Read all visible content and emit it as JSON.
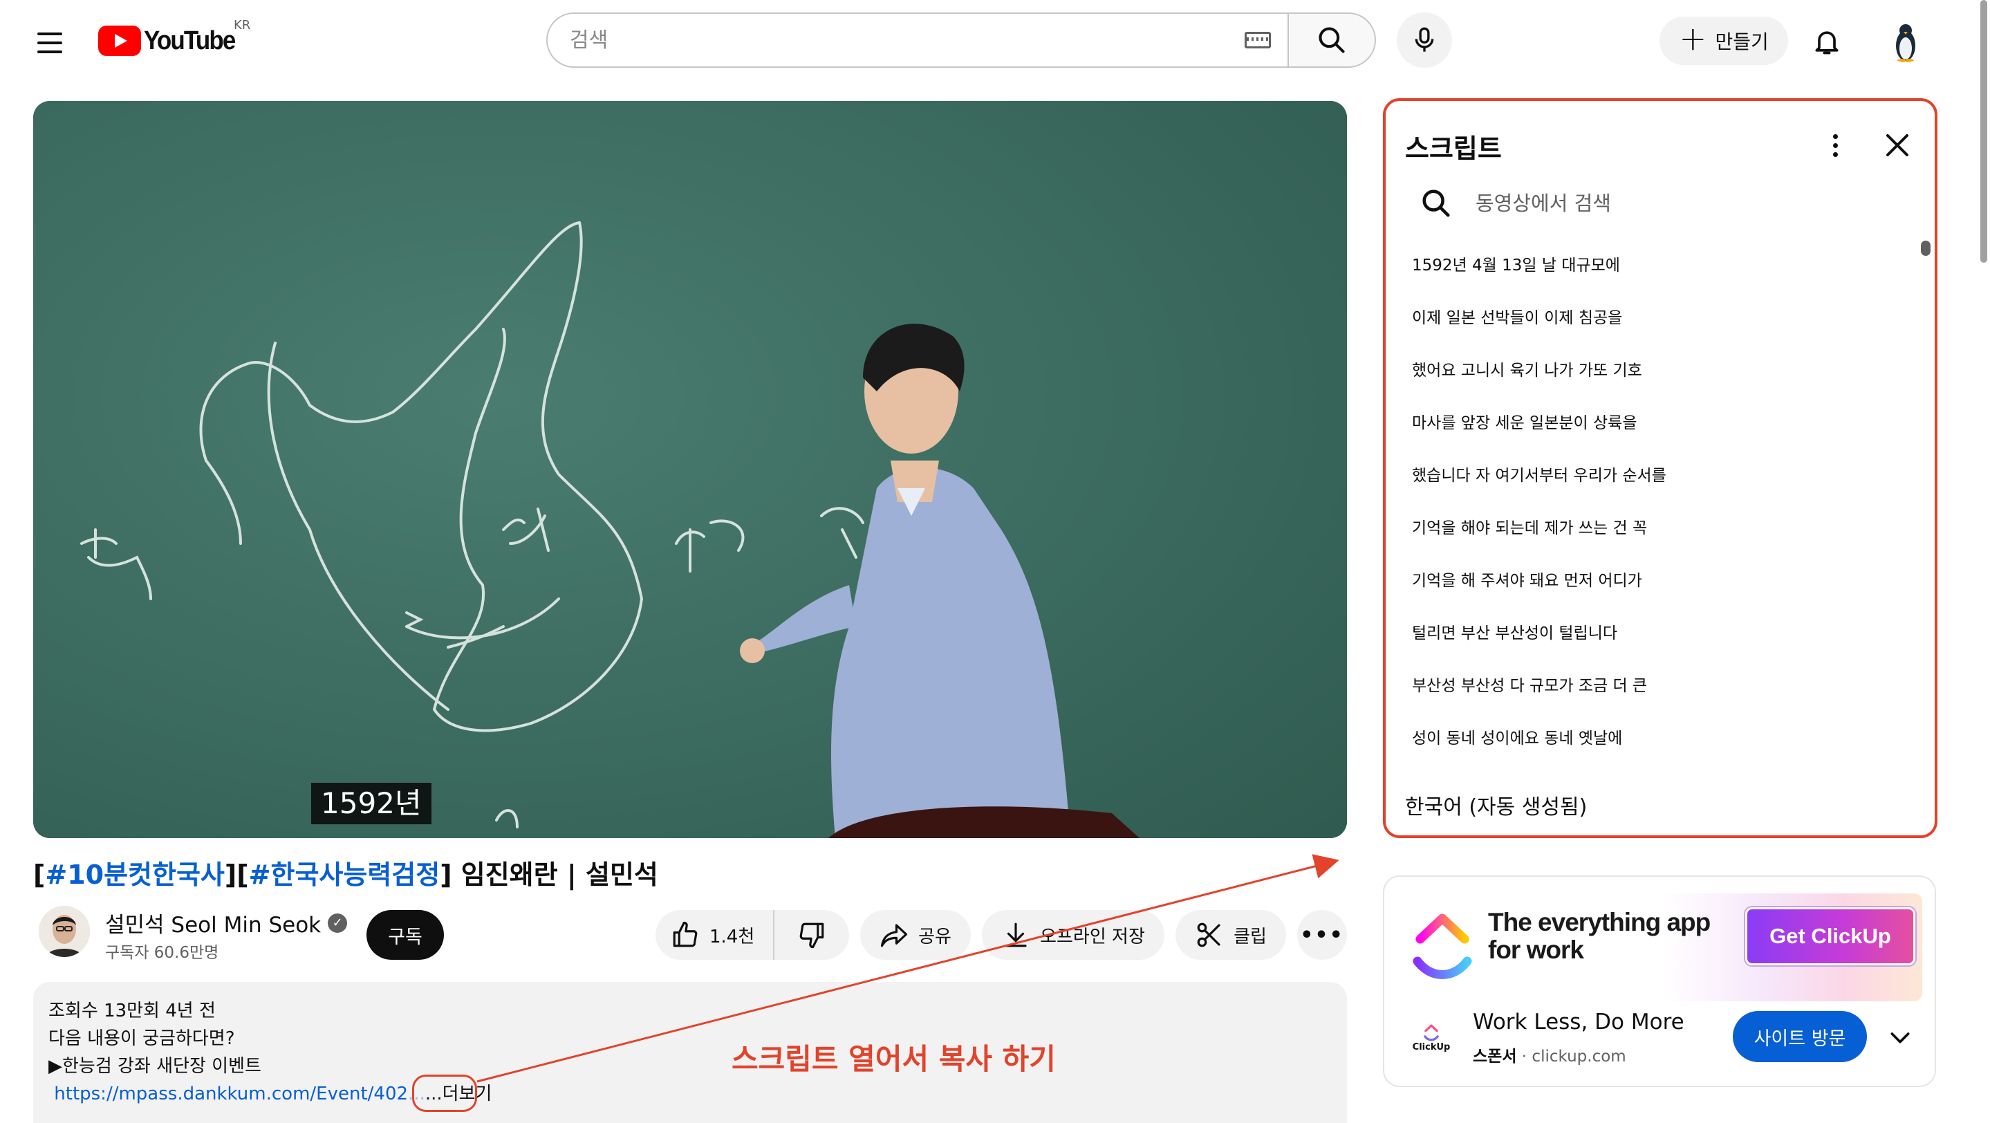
{
  "header": {
    "logo_text": "YouTube",
    "country_code": "KR",
    "search_placeholder": "검색",
    "create_label": "만들기"
  },
  "video": {
    "caption": "1592년",
    "title_tag1": "#10분컷한국사",
    "title_tag2": "#한국사능력검정",
    "title_rest": " 임진왜란 | 설민석"
  },
  "channel": {
    "name": "설민석 Seol Min Seok",
    "subscribers": "구독자 60.6만명",
    "subscribe_label": "구독"
  },
  "actions": {
    "likes": "1.4천",
    "share": "공유",
    "offline": "오프라인 저장",
    "clip": "클립"
  },
  "description": {
    "meta": "조회수 13만회  4년 전",
    "line1": "다음 내용이 궁금하다면?",
    "line2": "▶한능검 강좌 새단장 이벤트",
    "link": "https://mpass.dankkum.com/Event/402",
    "link_fade": "...",
    "more": "...더보기"
  },
  "annotation": {
    "text": "스크립트 열어서 복사 하기",
    "color": "#e2432b"
  },
  "transcript": {
    "title": "스크립트",
    "search_placeholder": "동영상에서 검색",
    "segments": [
      "1592년 4월 13일 날 대규모에",
      "이제 일본 선박들이 이제 침공을",
      "했어요 고니시 육기 나가 가또 기호",
      "마사를 앞장 세운 일본분이 상륙을",
      "했습니다 자 여기서부터 우리가 순서를",
      "기억을 해야 되는데 제가 쓰는 건 꼭",
      "기억을 해 주셔야 돼요 먼저 어디가",
      "털리면 부산 부산성이 털립니다",
      "부산성 부산성 다 규모가 조금 더 큰",
      "성이 동네 성이에요 동네 옛날에"
    ],
    "language": "한국어 (자동 생성됨)"
  },
  "ad": {
    "headline_line1": "The everything app",
    "headline_line2": "for work",
    "cta": "Get ClickUp",
    "logo_text": "ClickUp",
    "title": "Work Less, Do More",
    "sponsor_label": "스폰서",
    "sponsor_domain": " · clickup.com",
    "visit_label": "사이트 방문"
  },
  "colors": {
    "accent_red": "#e2432b",
    "link_blue": "#065fd4",
    "chalkboard": "#3f6e62"
  }
}
